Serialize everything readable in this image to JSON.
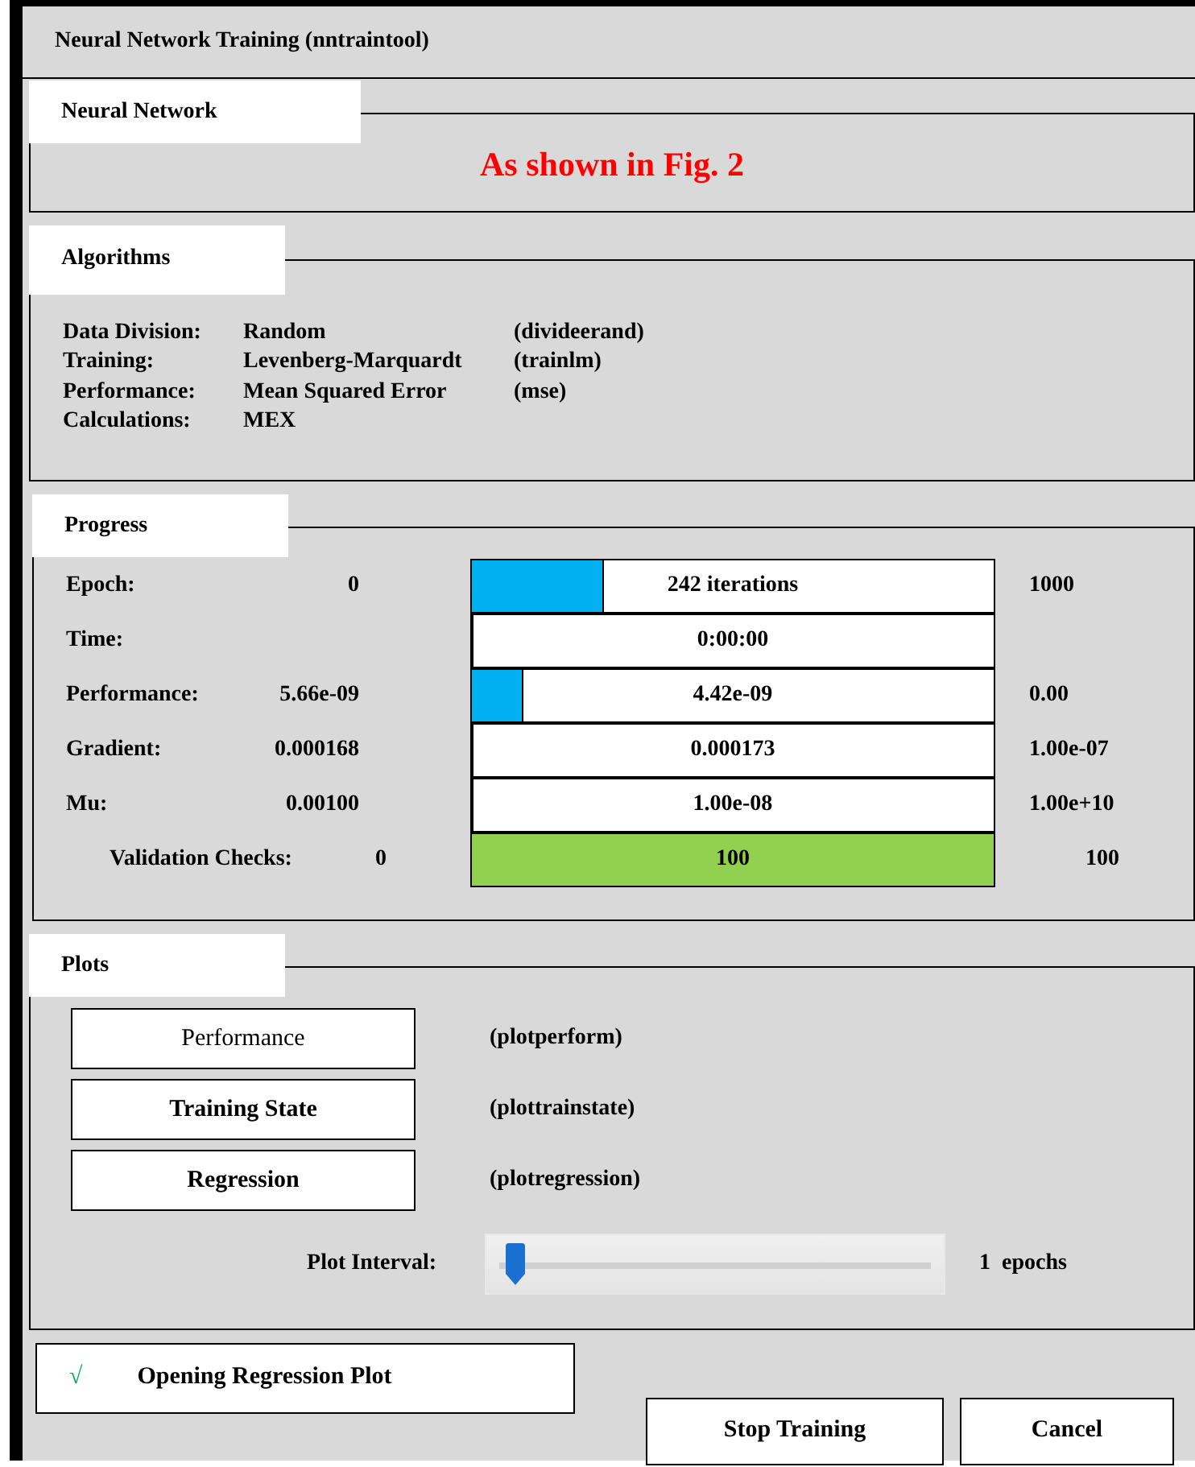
{
  "window": {
    "title": "Neural Network Training (nntraintool)"
  },
  "neural_network": {
    "title": "Neural Network",
    "note": "As shown in Fig. 2"
  },
  "algorithms": {
    "title": "Algorithms",
    "rows": [
      {
        "label": "Data Division:",
        "value": "Random",
        "function": "(divideerand)"
      },
      {
        "label": "Training:",
        "value": "Levenberg-Marquardt",
        "function": "(trainlm)"
      },
      {
        "label": "Performance:",
        "value": "Mean Squared Error",
        "function": "(mse)"
      },
      {
        "label": "Calculations:",
        "value": "MEX"
      }
    ]
  },
  "progress": {
    "title": "Progress",
    "rows": [
      {
        "kind": "value",
        "label": "Epoch:",
        "start": "0",
        "bar": {
          "text": "242 iterations",
          "level": 0.25,
          "color": "#00b0f0"
        },
        "limit": "1000"
      },
      {
        "kind": "value",
        "label": "Time:",
        "bar": {
          "text": "0:00:00",
          "level": 0
        }
      },
      {
        "kind": "value",
        "label": "Performance:",
        "start": "5.66e-09",
        "bar": {
          "text": "4.42e-09",
          "level": 0.095,
          "color": "#00b0f0"
        },
        "limit": "0.00"
      },
      {
        "kind": "value",
        "label": "Gradient:",
        "start": "0.000168",
        "bar": {
          "text": "0.000173",
          "level": 0
        },
        "limit": "1.00e-07"
      },
      {
        "kind": "value",
        "label": "Mu:",
        "start": "0.00100",
        "bar": {
          "text": "1.00e-08",
          "level": 0
        },
        "limit": "1.00e+10"
      },
      {
        "kind": "checks",
        "label": "Validation Checks:",
        "start": "0",
        "bar": {
          "text": "100",
          "level": 1,
          "color": "#92d050"
        },
        "limit": "100"
      }
    ]
  },
  "plots": {
    "title": "Plots",
    "items": [
      {
        "button": "Performance",
        "bold": false,
        "function": "(plotperform)"
      },
      {
        "button": "Training State",
        "bold": true,
        "function": "(plottrainstate)"
      },
      {
        "button": "Regression",
        "bold": true,
        "function": "(plotregression)"
      }
    ],
    "interval": {
      "label": "Plot Interval:",
      "level": 0.02,
      "reading": "1  epochs"
    }
  },
  "status": {
    "icon": "√",
    "text": "Opening Regression Plot"
  },
  "buttons": [
    "Stop Training",
    "Cancel"
  ]
}
